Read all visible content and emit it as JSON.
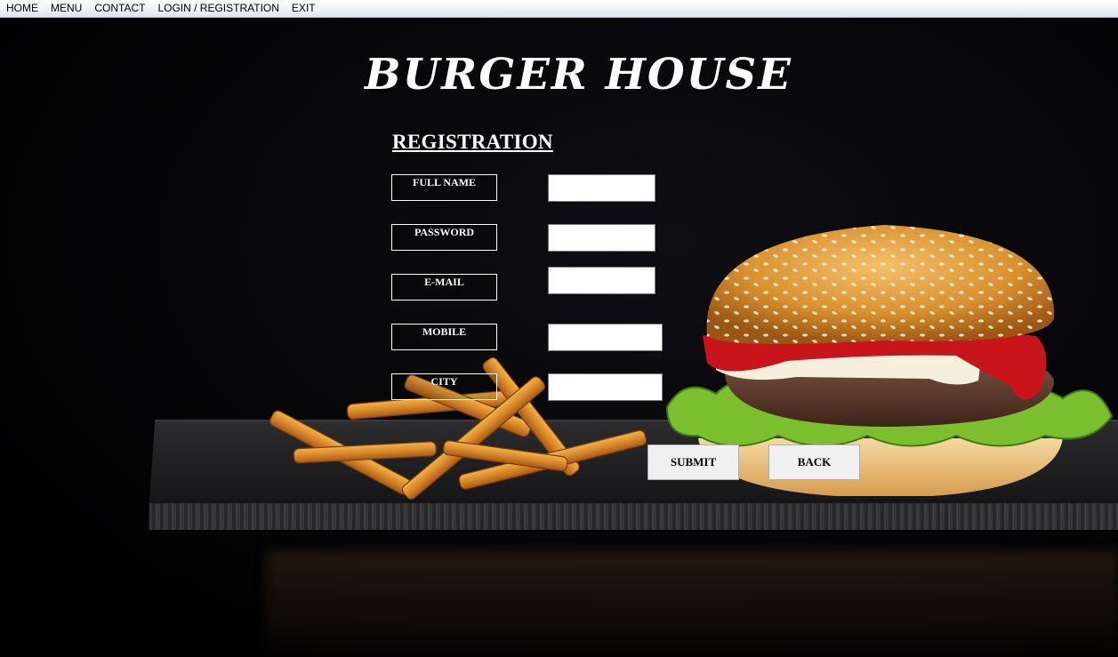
{
  "menubar": {
    "items": [
      "HOME",
      "MENU",
      "CONTACT",
      "LOGIN / REGISTRATION",
      "EXIT"
    ]
  },
  "title": "BURGER HOUSE",
  "form": {
    "heading": "REGISTRATION",
    "fields": [
      {
        "label": "FULL NAME",
        "value": ""
      },
      {
        "label": "PASSWORD",
        "value": ""
      },
      {
        "label": "E-MAIL",
        "value": ""
      },
      {
        "label": "MOBILE",
        "value": ""
      },
      {
        "label": "CITY",
        "value": ""
      }
    ],
    "submit_label": "SUBMIT",
    "back_label": "BACK"
  }
}
